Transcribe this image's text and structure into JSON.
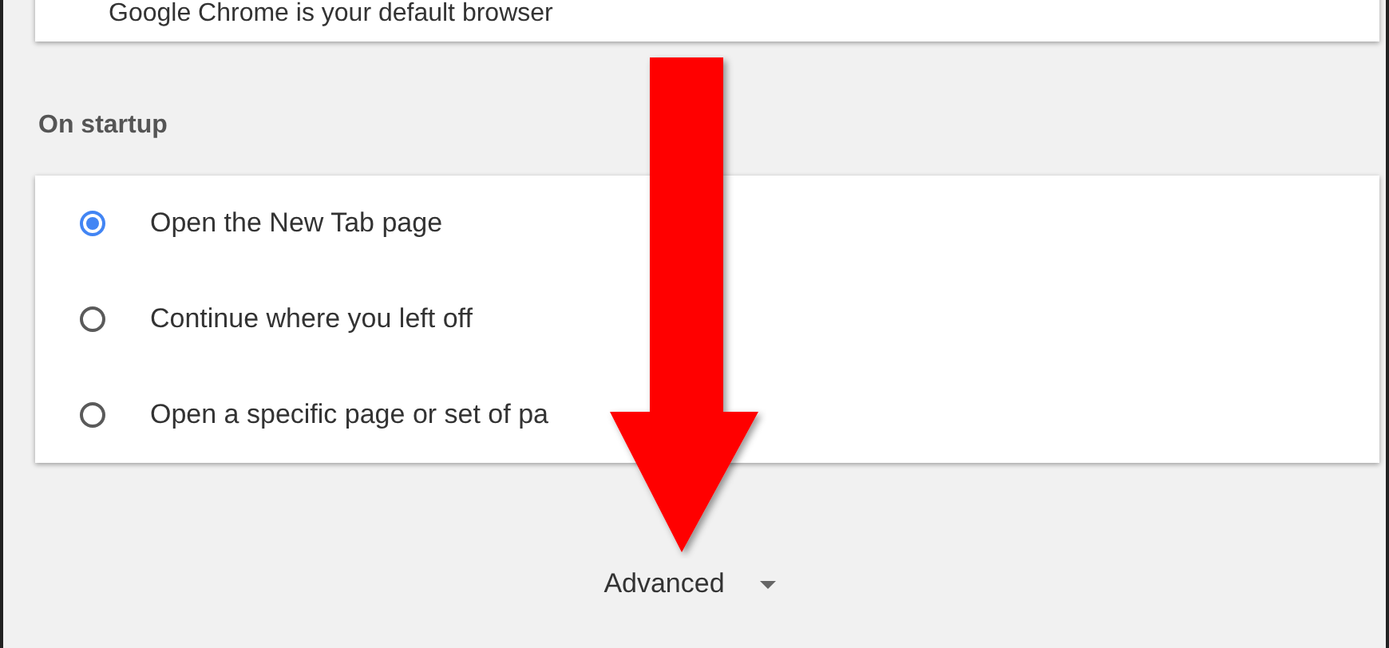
{
  "default_browser_card": {
    "text": "Google Chrome is your default browser"
  },
  "on_startup": {
    "heading": "On startup",
    "options": [
      {
        "label": "Open the New Tab page",
        "selected": true
      },
      {
        "label": "Continue where you left off",
        "selected": false
      },
      {
        "label": "Open a specific page or set of pa",
        "selected": false
      }
    ]
  },
  "advanced": {
    "label": "Advanced"
  }
}
